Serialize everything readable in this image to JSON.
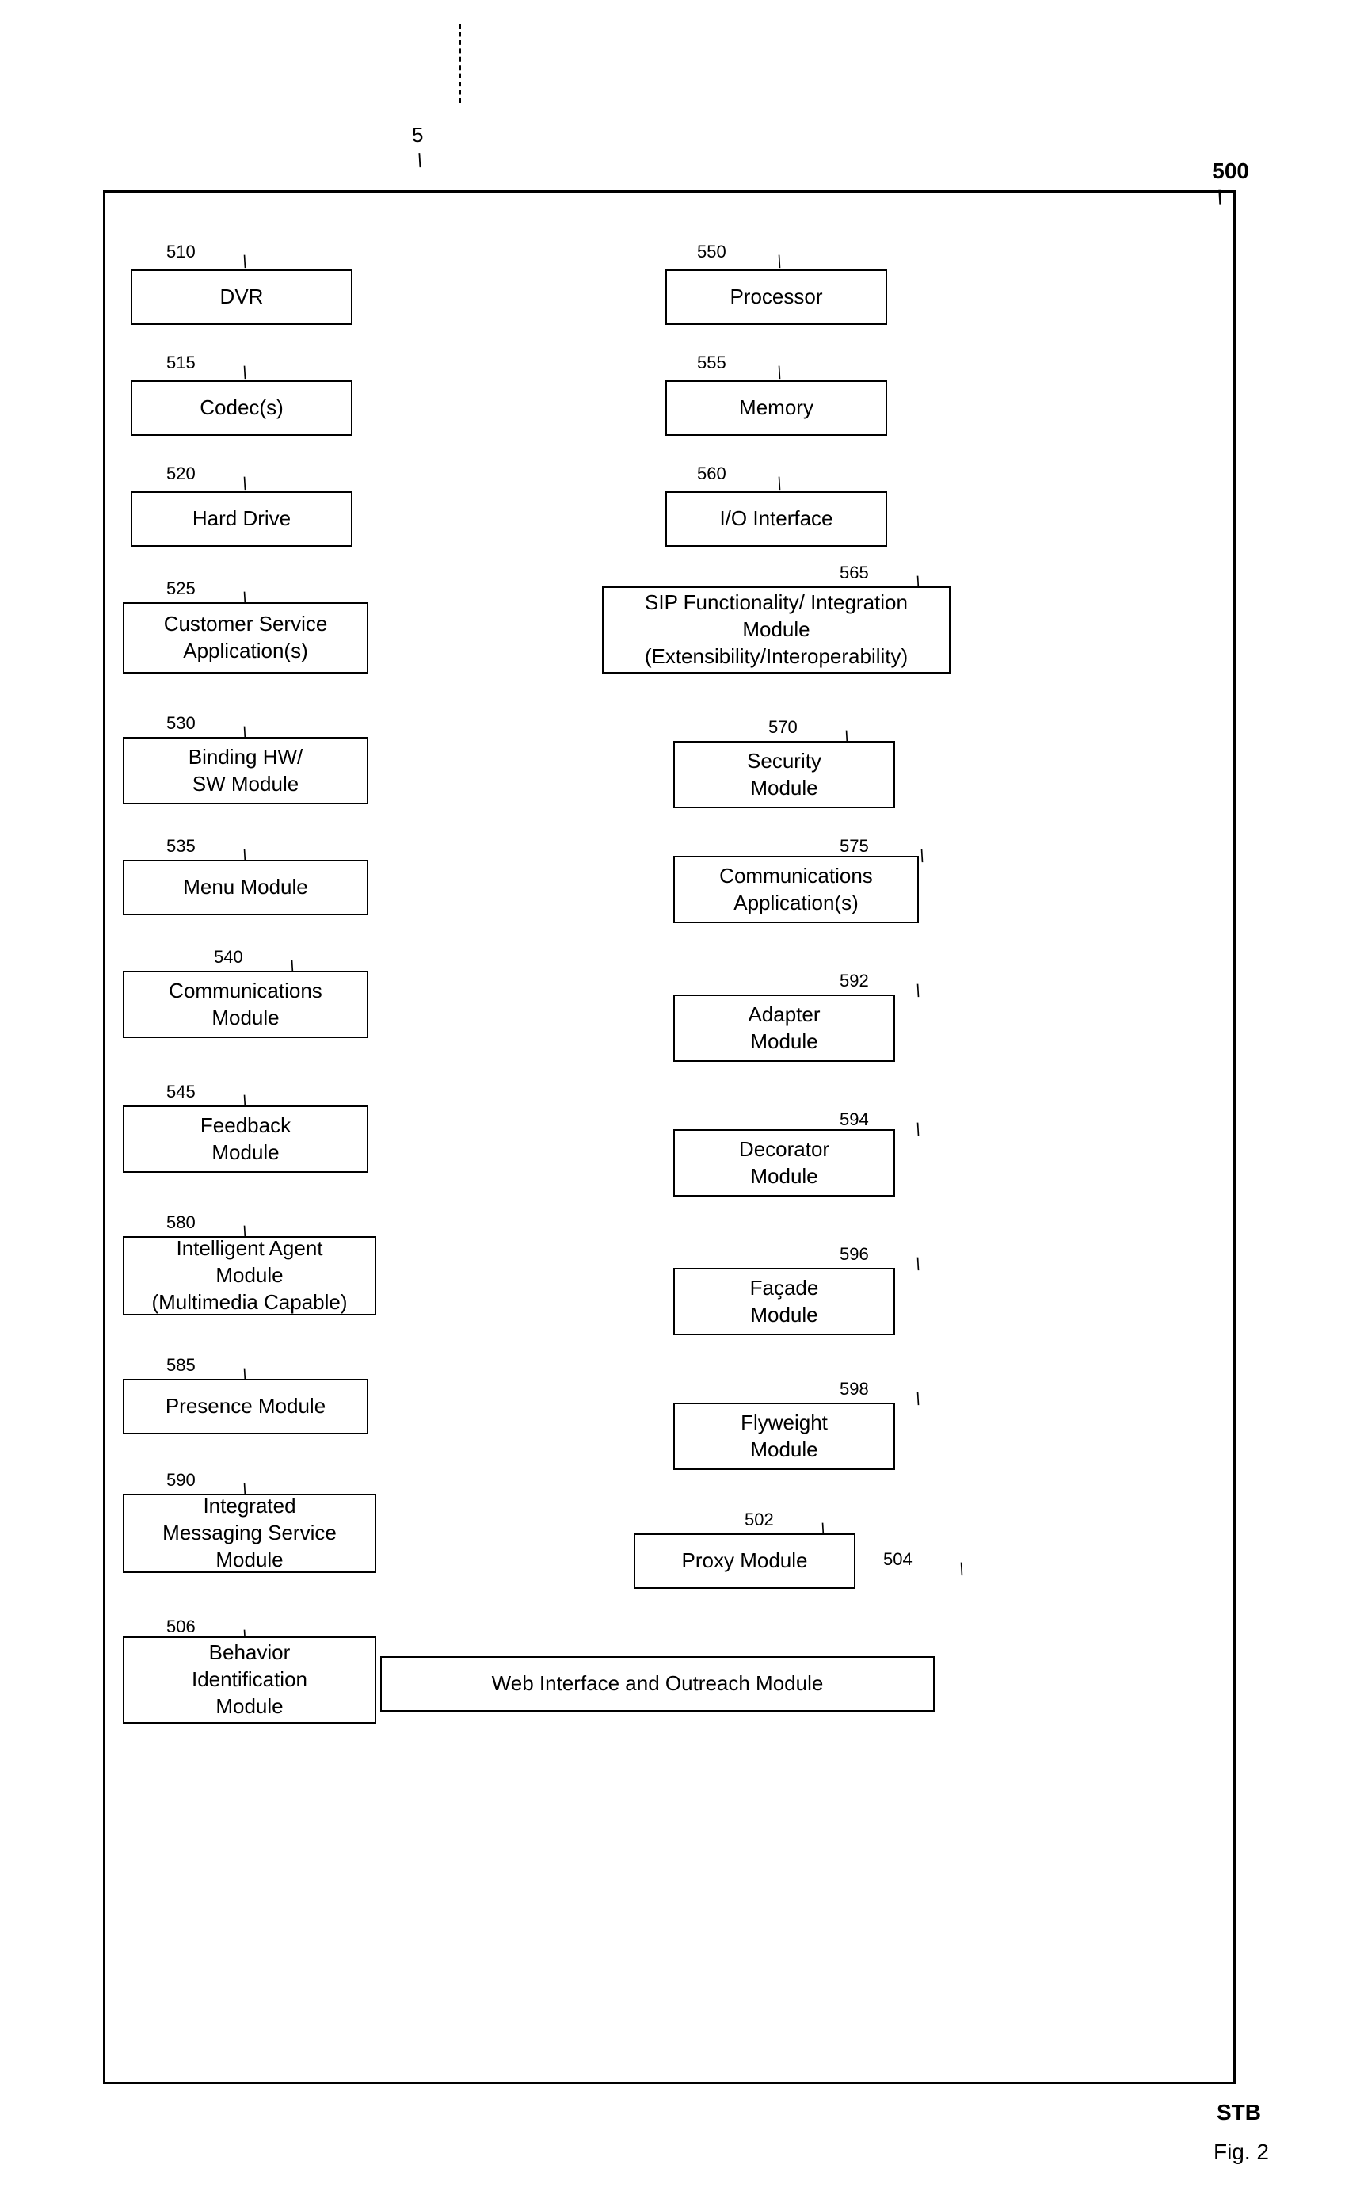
{
  "diagram": {
    "title": "Fig. 2",
    "top_ref": "5",
    "main_ref": "500",
    "stb_label": "STB",
    "modules": [
      {
        "id": "dvr",
        "label": "DVR",
        "ref": "510",
        "col": "left",
        "row": 1
      },
      {
        "id": "processor",
        "label": "Processor",
        "ref": "550",
        "col": "right",
        "row": 1
      },
      {
        "id": "codecs",
        "label": "Codec(s)",
        "ref": "515",
        "col": "left",
        "row": 2
      },
      {
        "id": "memory",
        "label": "Memory",
        "ref": "555",
        "col": "right",
        "row": 2
      },
      {
        "id": "harddrive",
        "label": "Hard Drive",
        "ref": "520",
        "col": "left",
        "row": 3
      },
      {
        "id": "io",
        "label": "I/O Interface",
        "ref": "560",
        "col": "right",
        "row": 3
      },
      {
        "id": "customerservice",
        "label": "Customer Service\nApplication(s)",
        "ref": "525",
        "col": "left",
        "row": 4
      },
      {
        "id": "sip",
        "label": "SIP Functionality/ Integration\nModule\n(Extensibility/Interoperability)",
        "ref": "565",
        "col": "right",
        "row": 4
      },
      {
        "id": "bindinghw",
        "label": "Binding HW/\nSW Module",
        "ref": "530",
        "col": "left",
        "row": 5
      },
      {
        "id": "security",
        "label": "Security\nModule",
        "ref": "570",
        "col": "right",
        "row": 5
      },
      {
        "id": "menumodule",
        "label": "Menu Module",
        "ref": "535",
        "col": "left",
        "row": 6
      },
      {
        "id": "commsapp",
        "label": "Communications\nApplication(s)",
        "ref": "575",
        "col": "right",
        "row": 6
      },
      {
        "id": "commsmodule",
        "label": "Communications\nModule",
        "ref": "540",
        "col": "left",
        "row": 7
      },
      {
        "id": "adapter",
        "label": "Adapter\nModule",
        "ref": "592",
        "col": "right",
        "row": 7
      },
      {
        "id": "feedback",
        "label": "Feedback\nModule",
        "ref": "545",
        "col": "left",
        "row": 8
      },
      {
        "id": "decorator",
        "label": "Decorator\nModule",
        "ref": "594",
        "col": "right",
        "row": 8
      },
      {
        "id": "intelligent",
        "label": "Intelligent Agent\nModule\n(Multimedia Capable)",
        "ref": "580",
        "col": "left",
        "row": 9
      },
      {
        "id": "facade",
        "label": "Façade\nModule",
        "ref": "596",
        "col": "right",
        "row": 9
      },
      {
        "id": "presence",
        "label": "Presence Module",
        "ref": "585",
        "col": "left",
        "row": 10
      },
      {
        "id": "flyweight",
        "label": "Flyweight\nModule",
        "ref": "598",
        "col": "right",
        "row": 10
      },
      {
        "id": "integrated",
        "label": "Integrated\nMessaging Service\nModule",
        "ref": "590",
        "col": "left",
        "row": 11
      },
      {
        "id": "proxy",
        "label": "Proxy Module",
        "ref": "502",
        "col": "right",
        "row": 11
      },
      {
        "id": "behavior",
        "label": "Behavior\nIdentification\nModule",
        "ref": "506",
        "col": "left",
        "row": 12
      },
      {
        "id": "webinterface",
        "label": "Web Interface and Outreach Module",
        "ref": "504",
        "col": "bottom",
        "row": 12
      }
    ]
  }
}
